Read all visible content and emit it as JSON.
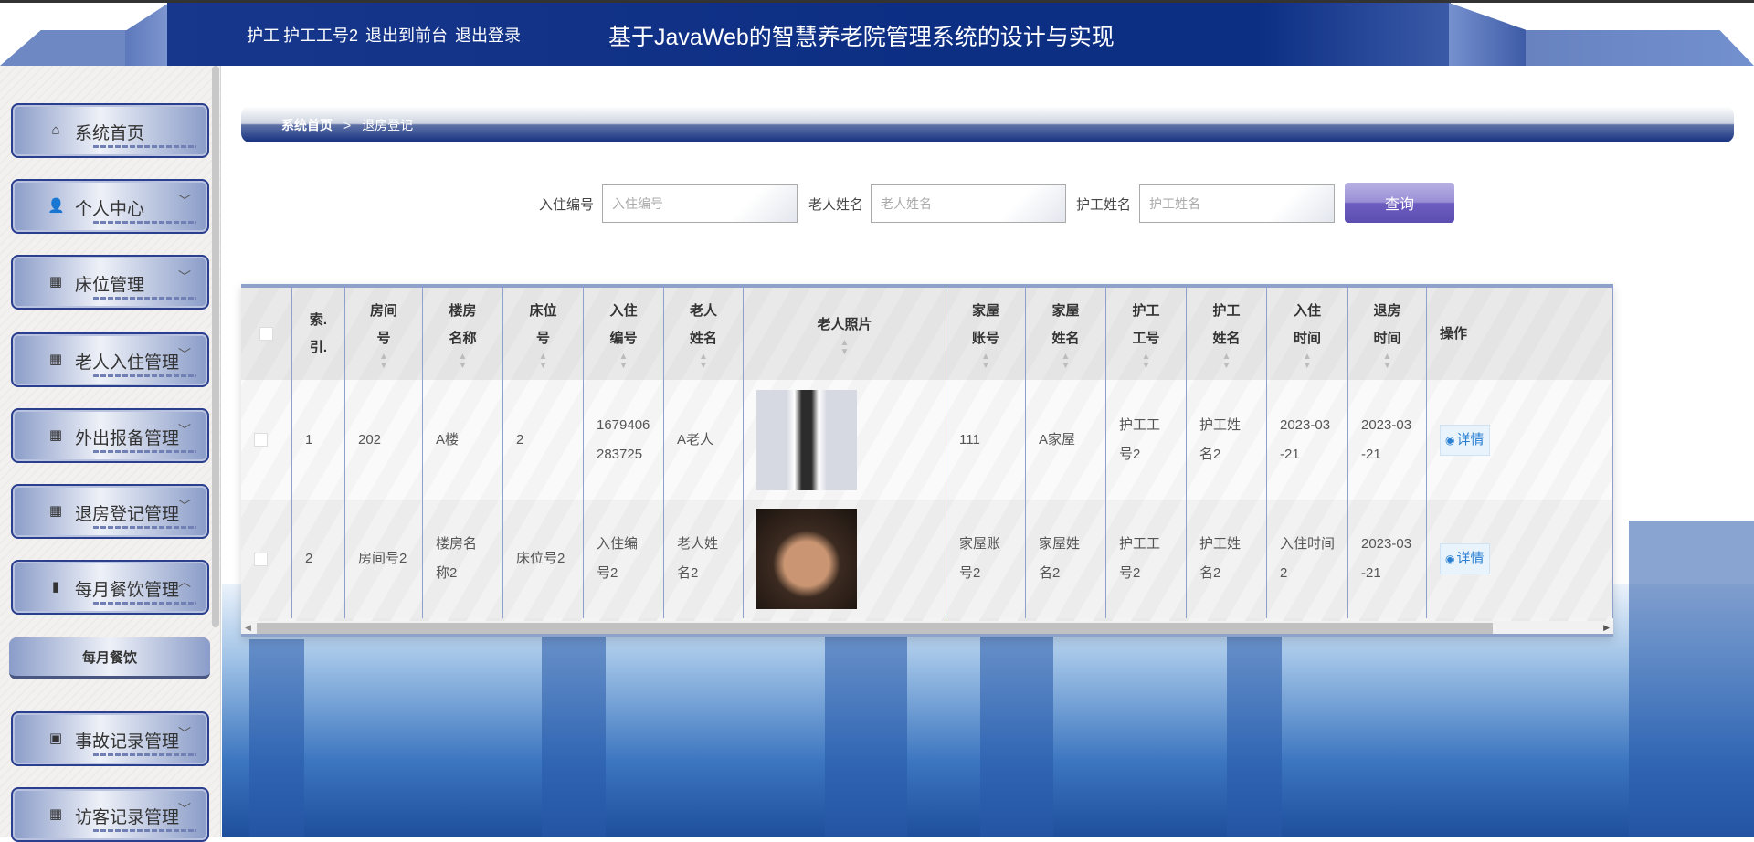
{
  "header": {
    "user_role": "护工",
    "user_name": "护工工号2",
    "back_to_front": "退出到前台",
    "logout": "退出登录",
    "title": "基于JavaWeb的智慧养老院管理系统的设计与实现",
    "colors": {
      "primary": "#0c2e83",
      "accent": "#6e88c4"
    }
  },
  "sidebar": {
    "items": [
      {
        "label": "系统首页",
        "icon": "home-icon"
      },
      {
        "label": "个人中心",
        "icon": "user-icon"
      },
      {
        "label": "床位管理",
        "icon": "grid-icon"
      },
      {
        "label": "老人入住管理",
        "icon": "grid-icon"
      },
      {
        "label": "外出报备管理",
        "icon": "grid-icon"
      },
      {
        "label": "退房登记管理",
        "icon": "grid-icon"
      },
      {
        "label": "每月餐饮管理",
        "icon": "bar-chart-icon",
        "expanded": true
      },
      {
        "label": "事故记录管理",
        "icon": "clipboard-x-icon"
      },
      {
        "label": "访客记录管理",
        "icon": "grid-icon"
      }
    ],
    "submenu": {
      "label": "每月餐饮"
    }
  },
  "breadcrumb": {
    "home": "系统首页",
    "separator": ">",
    "current": "退房登记"
  },
  "search": {
    "fields": [
      {
        "label": "入住编号",
        "placeholder": "入住编号",
        "value": ""
      },
      {
        "label": "老人姓名",
        "placeholder": "老人姓名",
        "value": ""
      },
      {
        "label": "护工姓名",
        "placeholder": "护工姓名",
        "value": ""
      }
    ],
    "button": "查询",
    "button_color": "#6d5dc0"
  },
  "table": {
    "headers": [
      "索引.",
      "房间号",
      "楼房名称",
      "床位号",
      "入住编号",
      "老人姓名",
      "老人照片",
      "家屋账号",
      "家屋姓名",
      "护工工号",
      "护工姓名",
      "入住时间",
      "退房时间",
      "操作"
    ],
    "headers_display": [
      "索.\n引.",
      "房间\n号",
      "楼房\n名称",
      "床位\n号",
      "入住\n编号",
      "老人\n姓名",
      "老人照片",
      "家屋\n账号",
      "家屋\n姓名",
      "护工\n工号",
      "护工\n姓名",
      "入住\n时间",
      "退房\n时间",
      "操作"
    ],
    "rows": [
      {
        "index": "1",
        "room": "202",
        "building": "A楼",
        "bed": "2",
        "checkin_no": "1679406283725",
        "elder_name": "A老人",
        "photo": "young-man-in-shirt-photo",
        "family_account": "111",
        "family_name": "A家屋",
        "nurse_no": "护工工号2",
        "nurse_name": "护工姓名2",
        "checkin_time": "2023-03-21",
        "checkout_time": "2023-03-21",
        "action": "详情"
      },
      {
        "index": "2",
        "room": "房间号2",
        "building": "楼房名称2",
        "bed": "床位号2",
        "checkin_no": "入住编号2",
        "elder_name": "老人姓名2",
        "photo": "elderly-woman-photo",
        "family_account": "家屋账号2",
        "family_name": "家屋姓名2",
        "nurse_no": "护工工号2",
        "nurse_name": "护工姓名2",
        "checkin_time": "入住时间2",
        "checkout_time": "2023-03-21",
        "action": "详情"
      }
    ]
  }
}
